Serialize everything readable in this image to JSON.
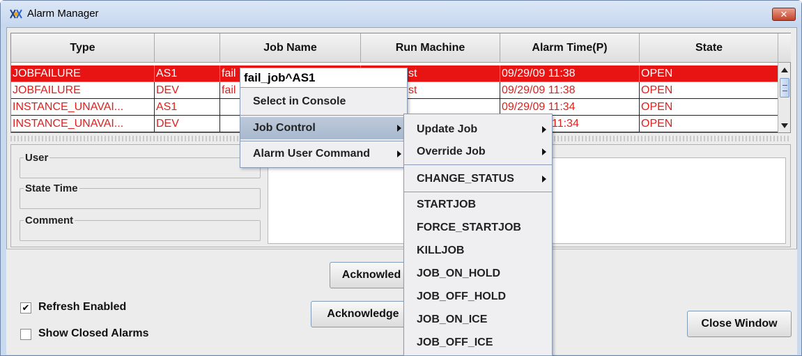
{
  "window": {
    "title": "Alarm Manager",
    "close_label": "✕"
  },
  "table": {
    "columns": [
      "Type",
      "",
      "Job Name",
      "Run Machine",
      "Alarm Time(P)",
      "State"
    ],
    "rows": [
      {
        "type": "JOBFAILURE",
        "instance": "AS1",
        "job_name": "fail",
        "run_machine": "st",
        "alarm_time": "09/29/09 11:38",
        "state": "OPEN"
      },
      {
        "type": "JOBFAILURE",
        "instance": "DEV",
        "job_name": "fail",
        "run_machine": "st",
        "alarm_time": "09/29/09 11:38",
        "state": "OPEN"
      },
      {
        "type": "INSTANCE_UNAVAI...",
        "instance": "AS1",
        "job_name": "",
        "run_machine": "",
        "alarm_time": "09/29/09 11:34",
        "state": "OPEN"
      },
      {
        "type": "INSTANCE_UNAVAI...",
        "instance": "DEV",
        "job_name": "",
        "run_machine": "",
        "alarm_time": "11:34",
        "state": "OPEN"
      }
    ]
  },
  "detail": {
    "user_label": "User",
    "state_time_label": "State Time",
    "comment_label": "Comment"
  },
  "bottom": {
    "acknowledge_label": "Acknowled",
    "acknowledge2_label": "Acknowledge",
    "refresh_label": "Refresh Enabled",
    "refresh_checked": "✔",
    "show_closed_label": "Show Closed Alarms",
    "close_window_label": "Close Window"
  },
  "context_menu": {
    "title": "fail_job^AS1",
    "items": [
      "Select in Console",
      "Job Control",
      "Alarm User Command"
    ]
  },
  "submenu": {
    "items": [
      "Update Job",
      "Override Job",
      "CHANGE_STATUS"
    ],
    "actions": [
      "STARTJOB",
      "FORCE_STARTJOB",
      "KILLJOB",
      "JOB_ON_HOLD",
      "JOB_OFF_HOLD",
      "JOB_ON_ICE",
      "JOB_OFF_ICE"
    ]
  }
}
